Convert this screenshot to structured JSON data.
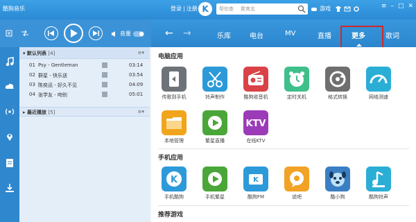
{
  "window": {
    "title": "酷狗音乐",
    "login": "登录",
    "separator": "|",
    "register": "注册",
    "logo": "K",
    "search_placeholder": "帮你查",
    "search_keyword": "聚爽志",
    "game_label": "游戏",
    "close": "✕",
    "minimize": "–",
    "maximize": "□",
    "menu": "≡"
  },
  "player": {
    "mute_label": "音量"
  },
  "nav": {
    "back": "←",
    "forward": "→",
    "tabs": [
      "乐库",
      "电台",
      "MV",
      "直播",
      "更多",
      "歌词"
    ],
    "active_tab": "更多"
  },
  "playlist": {
    "default_list": {
      "title": "默认列表",
      "count": "[4]",
      "menu": "≡▾"
    },
    "tracks": [
      {
        "index": "01",
        "name": "Psy - Gentleman",
        "duration": "03:14"
      },
      {
        "index": "02",
        "name": "群星 - 快乐送",
        "duration": "03:54"
      },
      {
        "index": "03",
        "name": "陈奕迅 - 好久不见",
        "duration": "04:09"
      },
      {
        "index": "04",
        "name": "张学友 - 吻别",
        "duration": "05:01"
      }
    ],
    "recent": {
      "title": "最近播放",
      "count": "[5]",
      "menu": "≡▾"
    }
  },
  "sections": {
    "pc_apps": {
      "title": "电脑应用",
      "items": [
        {
          "label": "传歌到手机",
          "icon": "phone-transfer-icon",
          "color": "#6d7378"
        },
        {
          "label": "铃声制作",
          "icon": "scissors-icon",
          "color": "#2c9ad9"
        },
        {
          "label": "酷狗收音机",
          "icon": "radio-icon",
          "color": "#d94246"
        },
        {
          "label": "定时关机",
          "icon": "alarm-clock-icon",
          "color": "#3fbf8a"
        },
        {
          "label": "格式转换",
          "icon": "convert-icon",
          "color": "#6f6f6f"
        },
        {
          "label": "网络测速",
          "icon": "speedometer-icon",
          "color": "#2aaed6"
        },
        {
          "label": "本地管理",
          "icon": "folder-icon",
          "color": "#f0a51c"
        },
        {
          "label": "繁星直播",
          "icon": "live-play-icon",
          "color": "#4aa638"
        },
        {
          "label": "在线KTV",
          "icon": "ktv-icon",
          "color": "#9c3bb8"
        }
      ]
    },
    "mobile_apps": {
      "title": "手机应用",
      "items": [
        {
          "label": "手机酷狗",
          "icon": "kugou-mobile-icon",
          "color": "#2c9ad9"
        },
        {
          "label": "手机繁星",
          "icon": "fanxing-mobile-icon",
          "color": "#4aa638"
        },
        {
          "label": "酷狗FM",
          "icon": "kugou-fm-icon",
          "color": "#2c9ad9"
        },
        {
          "label": "说吧",
          "icon": "shuoba-icon",
          "color": "#f2a224"
        },
        {
          "label": "酷小狗",
          "icon": "puppy-icon",
          "color": "#3a7fc4"
        },
        {
          "label": "酷狗铃声",
          "icon": "ringtone-icon",
          "color": "#2aaed6"
        }
      ]
    },
    "games": {
      "title": "推荐游戏"
    }
  }
}
